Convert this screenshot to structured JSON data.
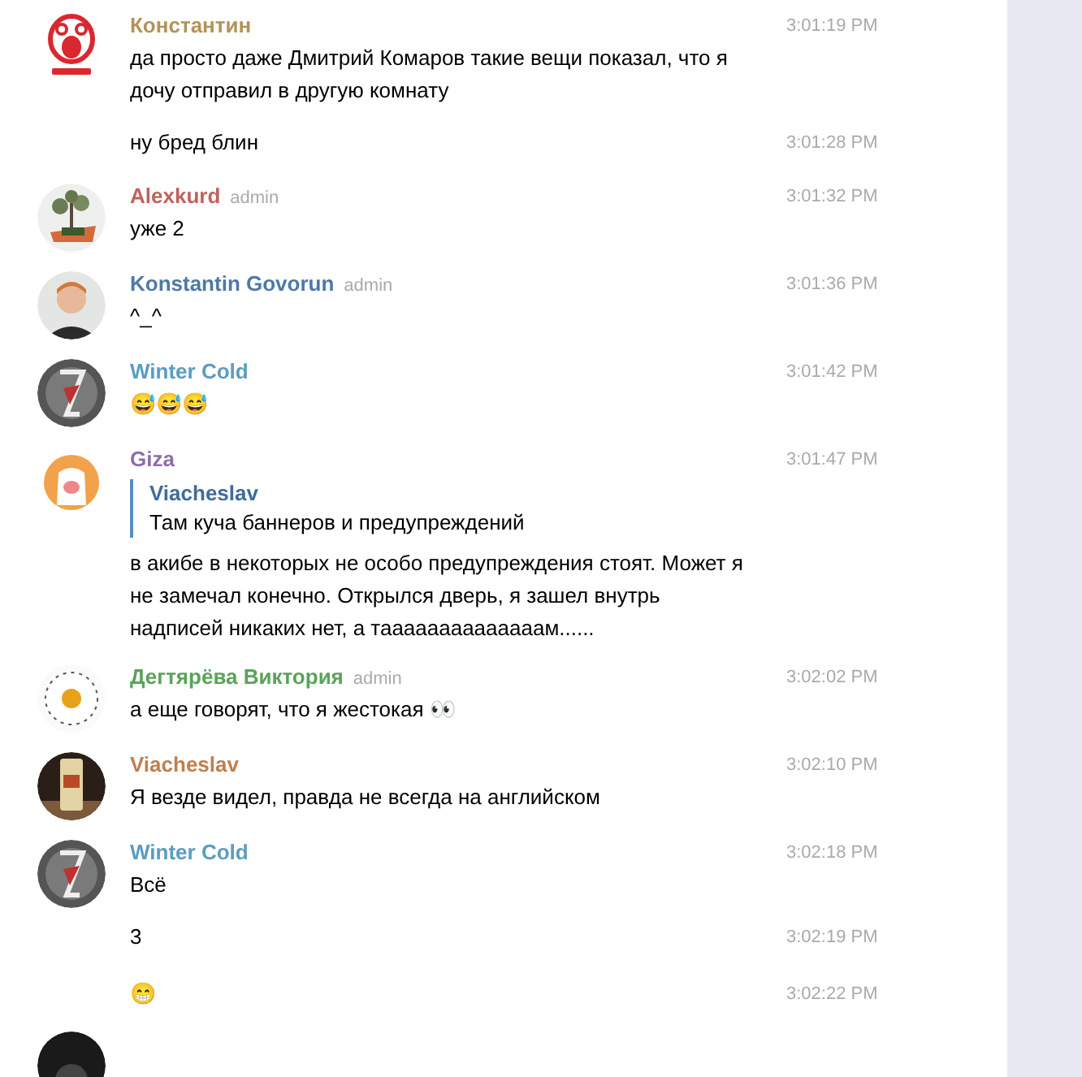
{
  "messages": [
    {
      "author": "Константин",
      "color": "#b3935a",
      "posts": [
        {
          "text": "да просто даже Дмитрий Комаров такие вещи показал, что я дочу отправил в другую комнату",
          "time": "3:01:19 PM"
        },
        {
          "text": "ну бред блин",
          "time": "3:01:28 PM"
        }
      ]
    },
    {
      "author": "Alexkurd",
      "color": "#c0625c",
      "badge": "admin",
      "posts": [
        {
          "text": "уже 2",
          "time": "3:01:32 PM"
        }
      ]
    },
    {
      "author": "Konstantin Govorun",
      "color": "#4e79a6",
      "badge": "admin",
      "posts": [
        {
          "text": "^_^",
          "time": "3:01:36 PM"
        }
      ]
    },
    {
      "author": "Winter Cold",
      "color": "#5a9dc2",
      "posts": [
        {
          "text": "😅😅😅",
          "time": "3:01:42 PM"
        }
      ]
    },
    {
      "author": "Giza",
      "color": "#8c6db0",
      "posts": [
        {
          "reply": {
            "author": "Viacheslav",
            "text": "Там куча баннеров и предупреждений"
          },
          "text": "в акибе в некоторых не особо предупреждения стоят. Может я не замечал конечно. Открылся дверь, я зашел внутрь надписей никаких нет, а таааааааааааааам......",
          "time": "3:01:47 PM"
        }
      ]
    },
    {
      "author": "Дегтярёва Виктория",
      "color": "#5aa35a",
      "badge": "admin",
      "posts": [
        {
          "text": "а еще говорят, что я жестокая 👀",
          "time": "3:02:02 PM"
        }
      ]
    },
    {
      "author": "Viacheslav",
      "color": "#c17f4e",
      "posts": [
        {
          "text": "Я везде видел, правда не всегда на английском",
          "time": "3:02:10 PM"
        }
      ]
    },
    {
      "author": "Winter Cold",
      "color": "#5a9dc2",
      "posts": [
        {
          "text": "Всё",
          "time": "3:02:18 PM"
        },
        {
          "text": "3",
          "time": "3:02:19 PM"
        },
        {
          "text": "😁",
          "time": "3:02:22 PM"
        }
      ]
    }
  ]
}
